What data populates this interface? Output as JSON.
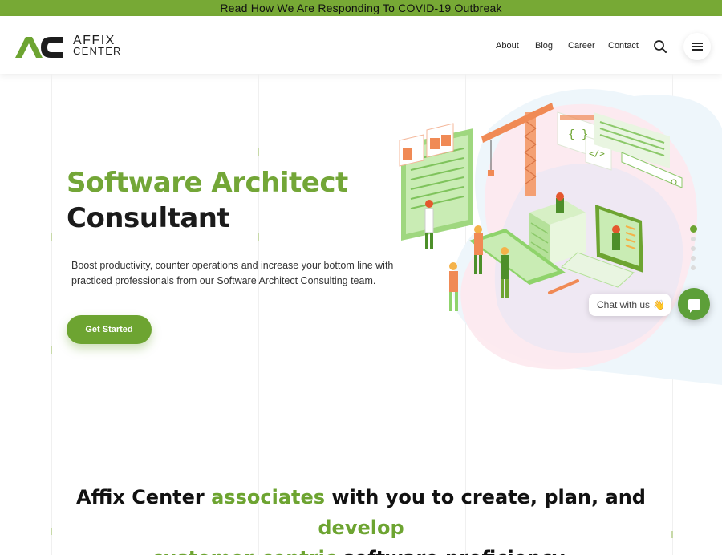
{
  "announcement": "Read How We Are Responding To COVID-19 Outbreak",
  "brand": {
    "mark": "AC",
    "line1": "AFFIX",
    "line2": "CENTER"
  },
  "nav": {
    "items": [
      "About",
      "Blog",
      "Career",
      "Contact"
    ]
  },
  "hero": {
    "title_line1": "Software Architect",
    "title_line2": "Consultant",
    "description": "Boost productivity, counter operations and increase your bottom line with practiced professionals from our Software Architect Consulting team.",
    "cta_label": "Get Started"
  },
  "slider": {
    "count": 5,
    "active_index": 0
  },
  "chat": {
    "label": "Chat with us",
    "emoji": "👋"
  },
  "tagline": {
    "part1": "Affix Center ",
    "hl1": "associates",
    "part2": " with you to create, plan, and ",
    "hl2": "develop",
    "hl3": "customer-centric",
    "part3": " software proficiency."
  },
  "colors": {
    "brand_green": "#6da431",
    "topbar": "#77a935",
    "illustration_orange": "#f08a55"
  }
}
